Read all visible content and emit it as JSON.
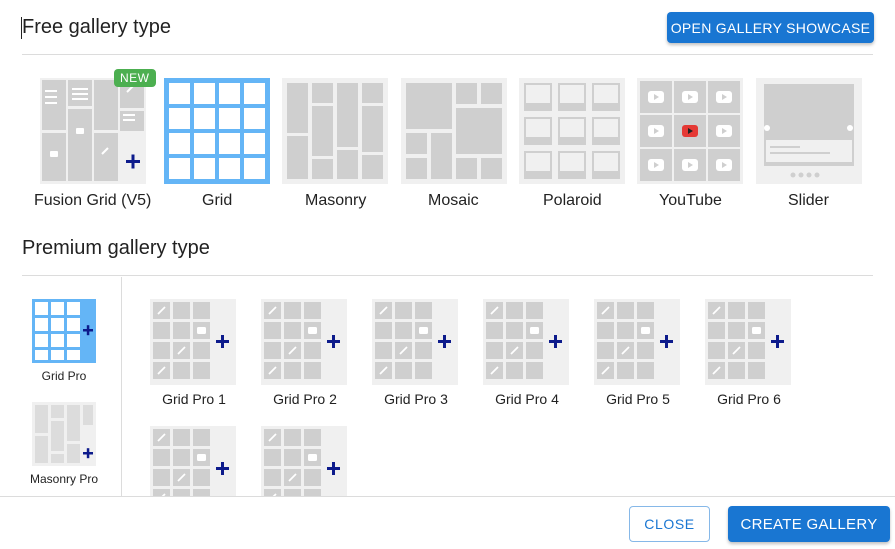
{
  "free_section": {
    "title": "Free gallery type",
    "showcase_button": "OPEN GALLERY SHOWCASE",
    "types": [
      {
        "label": "Fusion Grid (V5)",
        "badge": "NEW",
        "icon": "fusion-grid-thumbnail"
      },
      {
        "label": "Grid",
        "icon": "grid-thumbnail",
        "selected": true
      },
      {
        "label": "Masonry",
        "icon": "masonry-thumbnail"
      },
      {
        "label": "Mosaic",
        "icon": "mosaic-thumbnail"
      },
      {
        "label": "Polaroid",
        "icon": "polaroid-thumbnail"
      },
      {
        "label": "YouTube",
        "icon": "youtube-thumbnail"
      },
      {
        "label": "Slider",
        "icon": "slider-thumbnail"
      }
    ]
  },
  "premium_section": {
    "title": "Premium gallery type",
    "categories": [
      {
        "label": "Grid Pro",
        "icon": "grid-pro-thumbnail",
        "selected": true
      },
      {
        "label": "Masonry Pro",
        "icon": "masonry-pro-thumbnail"
      }
    ],
    "items": [
      {
        "label": "Grid Pro 1"
      },
      {
        "label": "Grid Pro 2"
      },
      {
        "label": "Grid Pro 3"
      },
      {
        "label": "Grid Pro 4"
      },
      {
        "label": "Grid Pro 5"
      },
      {
        "label": "Grid Pro 6"
      },
      {
        "label": ""
      },
      {
        "label": ""
      }
    ]
  },
  "footer": {
    "close_label": "CLOSE",
    "create_label": "CREATE GALLERY"
  },
  "colors": {
    "accent": "#1976d2",
    "selected_thumb": "#64b5f6",
    "badge_green": "#4caf50",
    "plus_navy": "#0d1b8c",
    "youtube_red": "#e53935"
  }
}
